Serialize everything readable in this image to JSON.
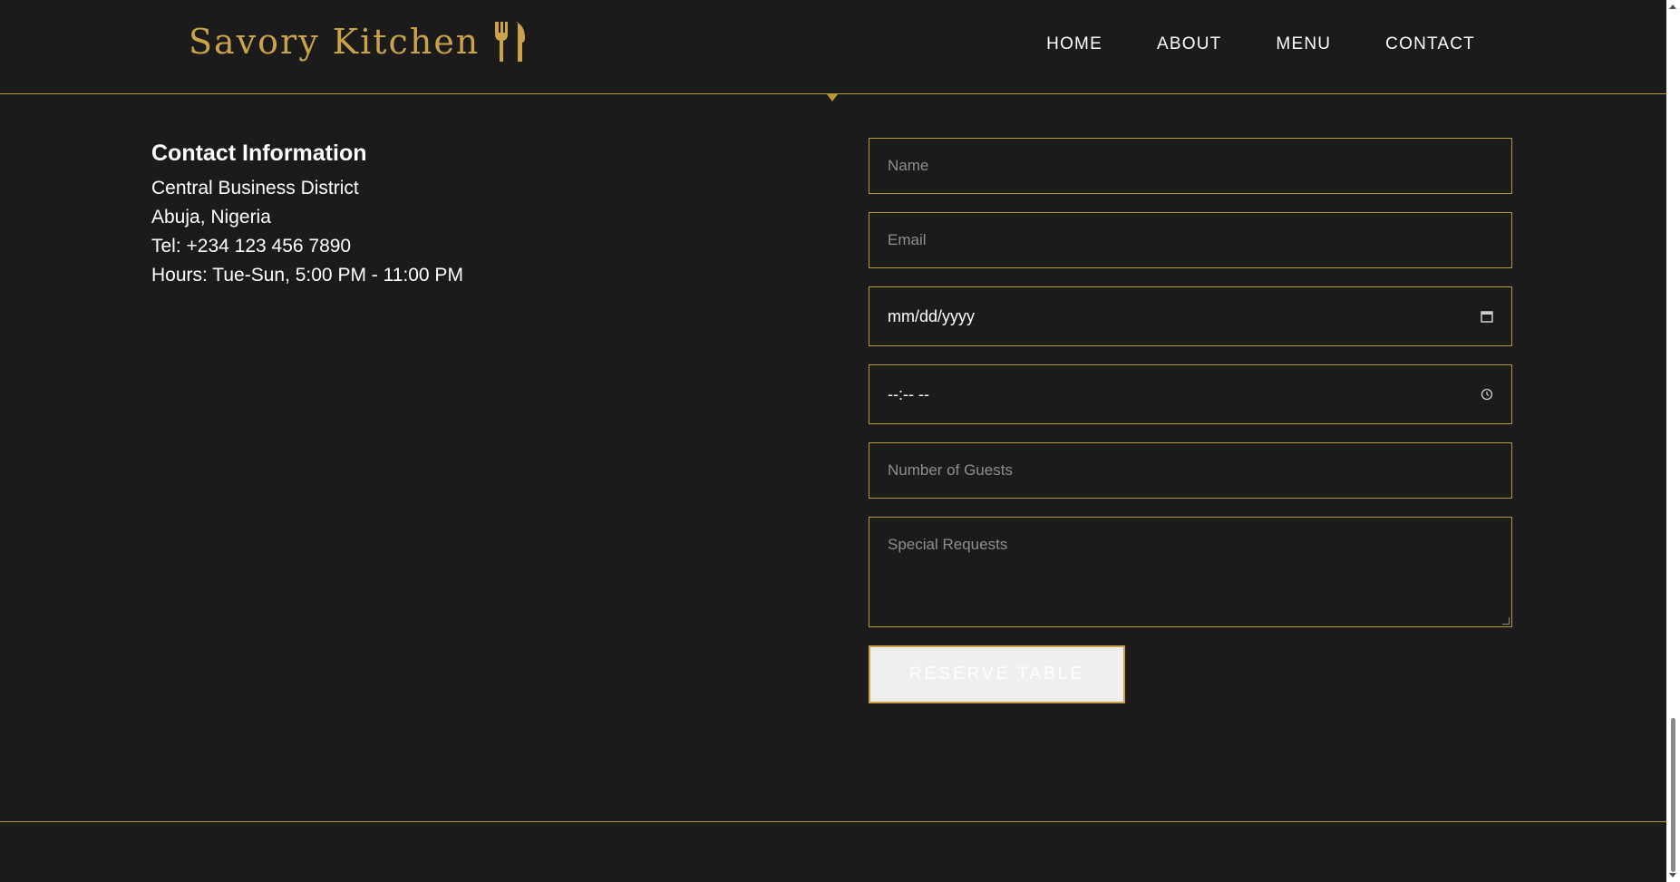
{
  "brand": {
    "name": "Savory Kitchen",
    "icon": "fork-knife-icon",
    "color": "#c9a24a"
  },
  "nav": {
    "items": [
      "HOME",
      "ABOUT",
      "MENU",
      "CONTACT"
    ]
  },
  "contact": {
    "heading": "Contact Information",
    "lines": [
      "Central Business District",
      "Abuja, Nigeria",
      "Tel: +234 123 456 7890",
      "Hours: Tue-Sun, 5:00 PM - 11:00 PM"
    ]
  },
  "form": {
    "name_placeholder": "Name",
    "email_placeholder": "Email",
    "date_value": "mm/dd/yyyy",
    "time_value": "--:-- --",
    "guests_placeholder": "Number of Guests",
    "requests_placeholder": "Special Requests",
    "submit_label": "RESERVE TABLE"
  },
  "colors": {
    "accent": "#bb973a",
    "background": "#1b1b1b",
    "text": "#ffffff",
    "placeholder": "#8e8e8e"
  }
}
